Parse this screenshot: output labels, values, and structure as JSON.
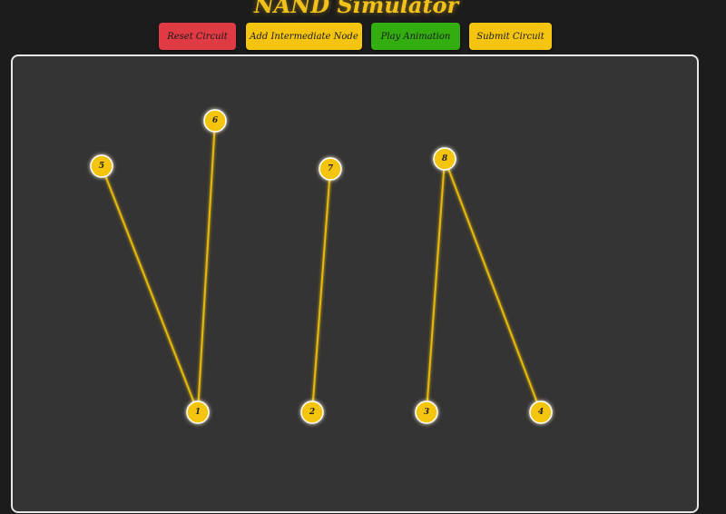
{
  "app": {
    "title": "NAND Simulator"
  },
  "toolbar": {
    "reset_label": "Reset Circuit",
    "add_label": "Add Intermediate Node",
    "play_label": "Play Animation",
    "submit_label": "Submit Circuit"
  },
  "colors": {
    "accent": "#f5c40f",
    "reset": "#e03a44",
    "play": "#33ad0f",
    "background": "#1c1c1c",
    "canvas": "#343434",
    "wire": "#e8b90f"
  },
  "nodes": [
    {
      "label": "1"
    },
    {
      "label": "2"
    },
    {
      "label": "3"
    },
    {
      "label": "4"
    },
    {
      "label": "5"
    },
    {
      "label": "6"
    },
    {
      "label": "7"
    },
    {
      "label": "8"
    }
  ],
  "connections": [
    {
      "from": "5",
      "to": "1"
    },
    {
      "from": "6",
      "to": "1"
    },
    {
      "from": "7",
      "to": "2"
    },
    {
      "from": "8",
      "to": "3"
    },
    {
      "from": "8",
      "to": "4"
    }
  ]
}
